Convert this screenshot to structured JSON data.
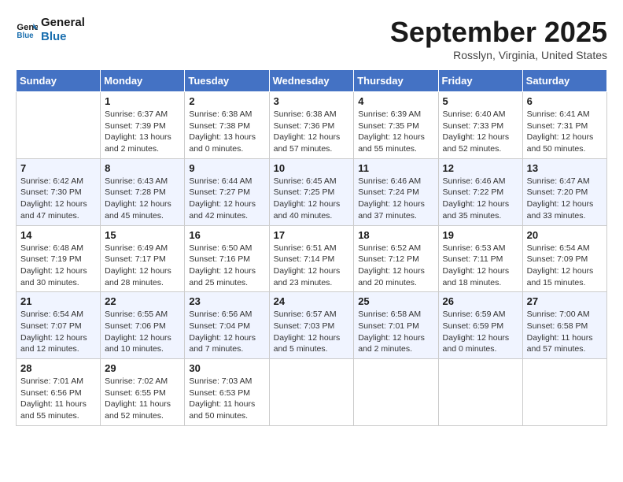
{
  "logo": {
    "line1": "General",
    "line2": "Blue"
  },
  "title": "September 2025",
  "subtitle": "Rosslyn, Virginia, United States",
  "days_of_week": [
    "Sunday",
    "Monday",
    "Tuesday",
    "Wednesday",
    "Thursday",
    "Friday",
    "Saturday"
  ],
  "weeks": [
    [
      {
        "day": "",
        "info": ""
      },
      {
        "day": "1",
        "info": "Sunrise: 6:37 AM\nSunset: 7:39 PM\nDaylight: 13 hours\nand 2 minutes."
      },
      {
        "day": "2",
        "info": "Sunrise: 6:38 AM\nSunset: 7:38 PM\nDaylight: 13 hours\nand 0 minutes."
      },
      {
        "day": "3",
        "info": "Sunrise: 6:38 AM\nSunset: 7:36 PM\nDaylight: 12 hours\nand 57 minutes."
      },
      {
        "day": "4",
        "info": "Sunrise: 6:39 AM\nSunset: 7:35 PM\nDaylight: 12 hours\nand 55 minutes."
      },
      {
        "day": "5",
        "info": "Sunrise: 6:40 AM\nSunset: 7:33 PM\nDaylight: 12 hours\nand 52 minutes."
      },
      {
        "day": "6",
        "info": "Sunrise: 6:41 AM\nSunset: 7:31 PM\nDaylight: 12 hours\nand 50 minutes."
      }
    ],
    [
      {
        "day": "7",
        "info": "Sunrise: 6:42 AM\nSunset: 7:30 PM\nDaylight: 12 hours\nand 47 minutes."
      },
      {
        "day": "8",
        "info": "Sunrise: 6:43 AM\nSunset: 7:28 PM\nDaylight: 12 hours\nand 45 minutes."
      },
      {
        "day": "9",
        "info": "Sunrise: 6:44 AM\nSunset: 7:27 PM\nDaylight: 12 hours\nand 42 minutes."
      },
      {
        "day": "10",
        "info": "Sunrise: 6:45 AM\nSunset: 7:25 PM\nDaylight: 12 hours\nand 40 minutes."
      },
      {
        "day": "11",
        "info": "Sunrise: 6:46 AM\nSunset: 7:24 PM\nDaylight: 12 hours\nand 37 minutes."
      },
      {
        "day": "12",
        "info": "Sunrise: 6:46 AM\nSunset: 7:22 PM\nDaylight: 12 hours\nand 35 minutes."
      },
      {
        "day": "13",
        "info": "Sunrise: 6:47 AM\nSunset: 7:20 PM\nDaylight: 12 hours\nand 33 minutes."
      }
    ],
    [
      {
        "day": "14",
        "info": "Sunrise: 6:48 AM\nSunset: 7:19 PM\nDaylight: 12 hours\nand 30 minutes."
      },
      {
        "day": "15",
        "info": "Sunrise: 6:49 AM\nSunset: 7:17 PM\nDaylight: 12 hours\nand 28 minutes."
      },
      {
        "day": "16",
        "info": "Sunrise: 6:50 AM\nSunset: 7:16 PM\nDaylight: 12 hours\nand 25 minutes."
      },
      {
        "day": "17",
        "info": "Sunrise: 6:51 AM\nSunset: 7:14 PM\nDaylight: 12 hours\nand 23 minutes."
      },
      {
        "day": "18",
        "info": "Sunrise: 6:52 AM\nSunset: 7:12 PM\nDaylight: 12 hours\nand 20 minutes."
      },
      {
        "day": "19",
        "info": "Sunrise: 6:53 AM\nSunset: 7:11 PM\nDaylight: 12 hours\nand 18 minutes."
      },
      {
        "day": "20",
        "info": "Sunrise: 6:54 AM\nSunset: 7:09 PM\nDaylight: 12 hours\nand 15 minutes."
      }
    ],
    [
      {
        "day": "21",
        "info": "Sunrise: 6:54 AM\nSunset: 7:07 PM\nDaylight: 12 hours\nand 12 minutes."
      },
      {
        "day": "22",
        "info": "Sunrise: 6:55 AM\nSunset: 7:06 PM\nDaylight: 12 hours\nand 10 minutes."
      },
      {
        "day": "23",
        "info": "Sunrise: 6:56 AM\nSunset: 7:04 PM\nDaylight: 12 hours\nand 7 minutes."
      },
      {
        "day": "24",
        "info": "Sunrise: 6:57 AM\nSunset: 7:03 PM\nDaylight: 12 hours\nand 5 minutes."
      },
      {
        "day": "25",
        "info": "Sunrise: 6:58 AM\nSunset: 7:01 PM\nDaylight: 12 hours\nand 2 minutes."
      },
      {
        "day": "26",
        "info": "Sunrise: 6:59 AM\nSunset: 6:59 PM\nDaylight: 12 hours\nand 0 minutes."
      },
      {
        "day": "27",
        "info": "Sunrise: 7:00 AM\nSunset: 6:58 PM\nDaylight: 11 hours\nand 57 minutes."
      }
    ],
    [
      {
        "day": "28",
        "info": "Sunrise: 7:01 AM\nSunset: 6:56 PM\nDaylight: 11 hours\nand 55 minutes."
      },
      {
        "day": "29",
        "info": "Sunrise: 7:02 AM\nSunset: 6:55 PM\nDaylight: 11 hours\nand 52 minutes."
      },
      {
        "day": "30",
        "info": "Sunrise: 7:03 AM\nSunset: 6:53 PM\nDaylight: 11 hours\nand 50 minutes."
      },
      {
        "day": "",
        "info": ""
      },
      {
        "day": "",
        "info": ""
      },
      {
        "day": "",
        "info": ""
      },
      {
        "day": "",
        "info": ""
      }
    ]
  ]
}
